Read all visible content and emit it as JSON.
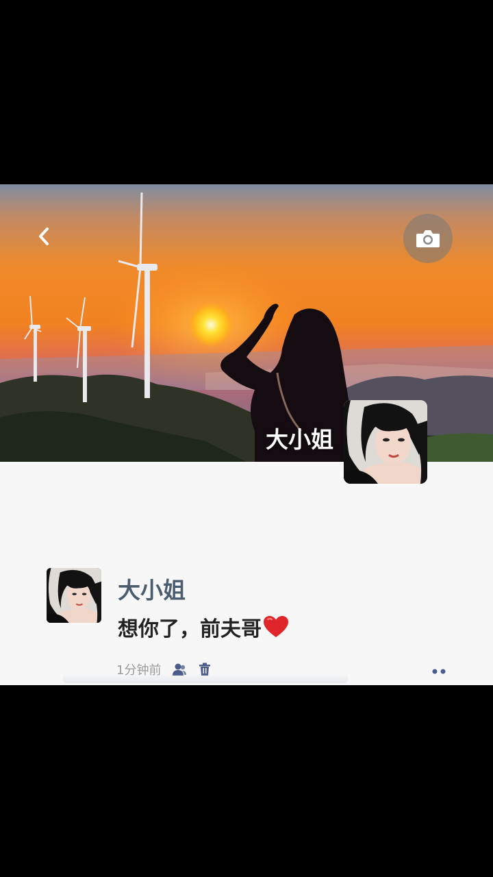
{
  "cover": {
    "username": "大小姐"
  },
  "post": {
    "author": "大小姐",
    "text": "想你了，前夫哥",
    "emoji": "❤️",
    "time": "1分钟前"
  },
  "icons": {
    "back": "chevron-left-icon",
    "camera": "camera-icon",
    "visibility": "people-icon",
    "delete": "trash-icon",
    "more": "more-dots-icon"
  },
  "colors": {
    "author_name": "#4a5d6e",
    "meta_text": "#9a9a9a",
    "icon_blue": "#4a5b8c",
    "heart": "#e0262b"
  }
}
